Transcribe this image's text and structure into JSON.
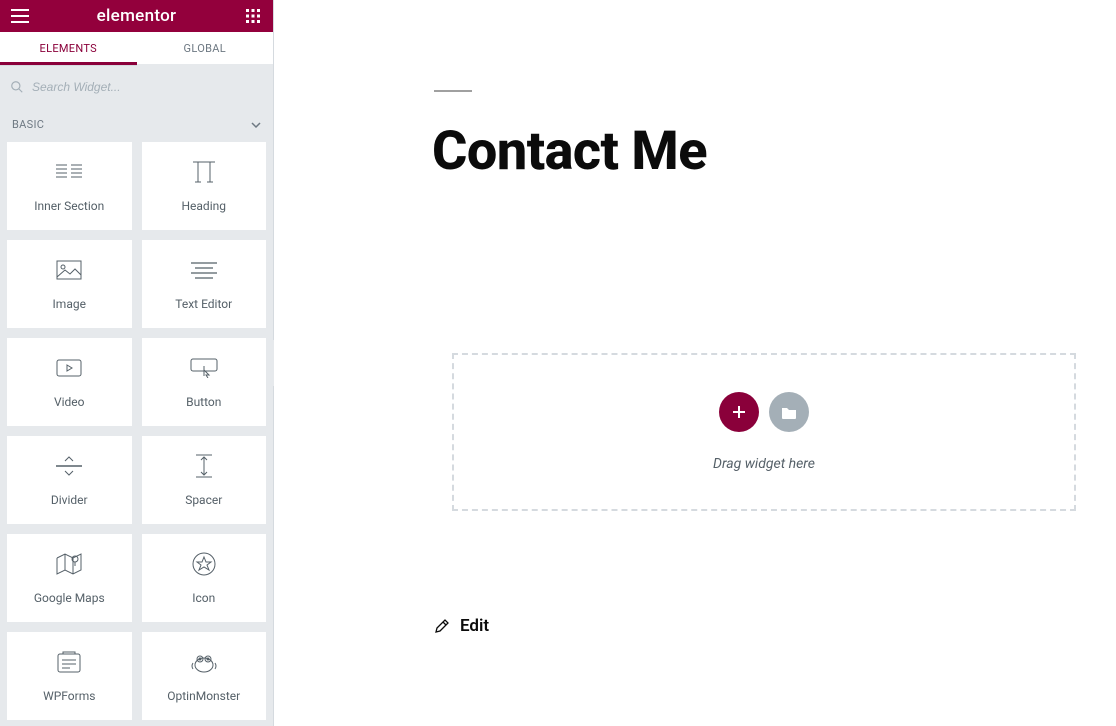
{
  "header": {
    "logo": "elementor"
  },
  "tabs": {
    "elements": "ELEMENTS",
    "global": "GLOBAL"
  },
  "search": {
    "placeholder": "Search Widget..."
  },
  "category": {
    "basic": "BASIC"
  },
  "widgets": [
    {
      "id": "inner-section",
      "label": "Inner Section"
    },
    {
      "id": "heading",
      "label": "Heading"
    },
    {
      "id": "image",
      "label": "Image"
    },
    {
      "id": "text-editor",
      "label": "Text Editor"
    },
    {
      "id": "video",
      "label": "Video"
    },
    {
      "id": "button",
      "label": "Button"
    },
    {
      "id": "divider",
      "label": "Divider"
    },
    {
      "id": "spacer",
      "label": "Spacer"
    },
    {
      "id": "google-maps",
      "label": "Google Maps"
    },
    {
      "id": "icon",
      "label": "Icon"
    },
    {
      "id": "wpforms",
      "label": "WPForms"
    },
    {
      "id": "optinmonster",
      "label": "OptinMonster"
    }
  ],
  "canvas": {
    "page_title": "Contact Me",
    "drop_caption": "Drag widget here",
    "edit_label": "Edit"
  },
  "colors": {
    "brand": "#8a003a"
  }
}
